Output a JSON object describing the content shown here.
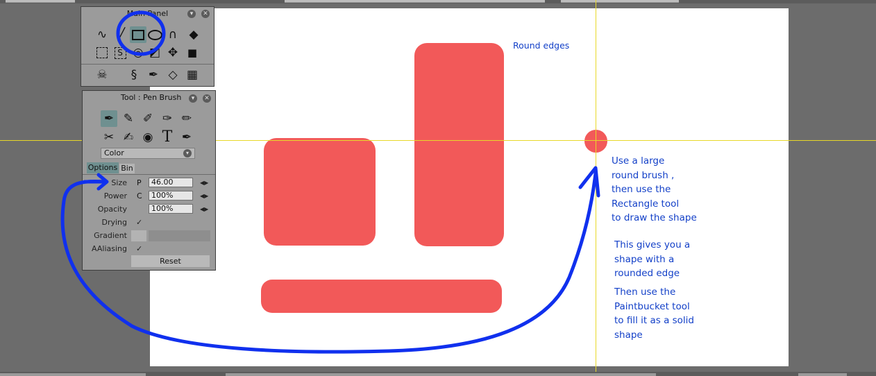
{
  "main_panel": {
    "title": "Main Panel",
    "tools_row1": [
      "squiggle-icon",
      "line-icon",
      "rectangle-icon",
      "ellipse-icon",
      "curve-icon",
      "eraser-icon"
    ],
    "tools_row2": [
      "selection-icon",
      "text-select-icon",
      "circle-target-icon",
      "transform-icon",
      "move-icon",
      "camera-icon"
    ],
    "tools_row3": [
      "skull-icon",
      "spiral-icon",
      "pen-icon",
      "page-icon",
      "grid-icon"
    ]
  },
  "tool_panel": {
    "title": "Tool : Pen Brush",
    "brushes_row1": [
      "pen-brush-icon",
      "marker-icon",
      "brush-icon",
      "airbrush-icon",
      "pencil-icon"
    ],
    "brushes_row2": [
      "knife-icon",
      "dropper-icon",
      "water-drop-icon",
      "text-tool-icon",
      "fill-pen-icon"
    ],
    "color_dropdown": "Color",
    "tabs": {
      "options": "Options",
      "bin": "Bin"
    },
    "size": {
      "label": "Size",
      "mode": "P",
      "value": "46.00"
    },
    "power": {
      "label": "Power",
      "mode": "C",
      "value": "100%"
    },
    "opacity": {
      "label": "Opacity",
      "value": "100%"
    },
    "drying": {
      "label": "Drying",
      "check": "✓"
    },
    "gradient": {
      "label": "Gradient"
    },
    "aaliasing": {
      "label": "AAliasing",
      "check": "✓"
    },
    "reset_label": "Reset"
  },
  "annotations": {
    "round_edges": "Round edges",
    "note1": "Use a large\nround brush ,\nthen use the\nRectangle tool\nto draw the shape",
    "note2": "This gives you a\nshape with a\nrounded edge",
    "note3": "Then use the\nPaintbucket tool\nto fill it as a solid\nshape"
  },
  "colors": {
    "shape": "#f25959",
    "guide": "#e8d829",
    "annotation": "#1340c8",
    "canvas": "#ffffff",
    "workspace": "#6c6c6c"
  }
}
